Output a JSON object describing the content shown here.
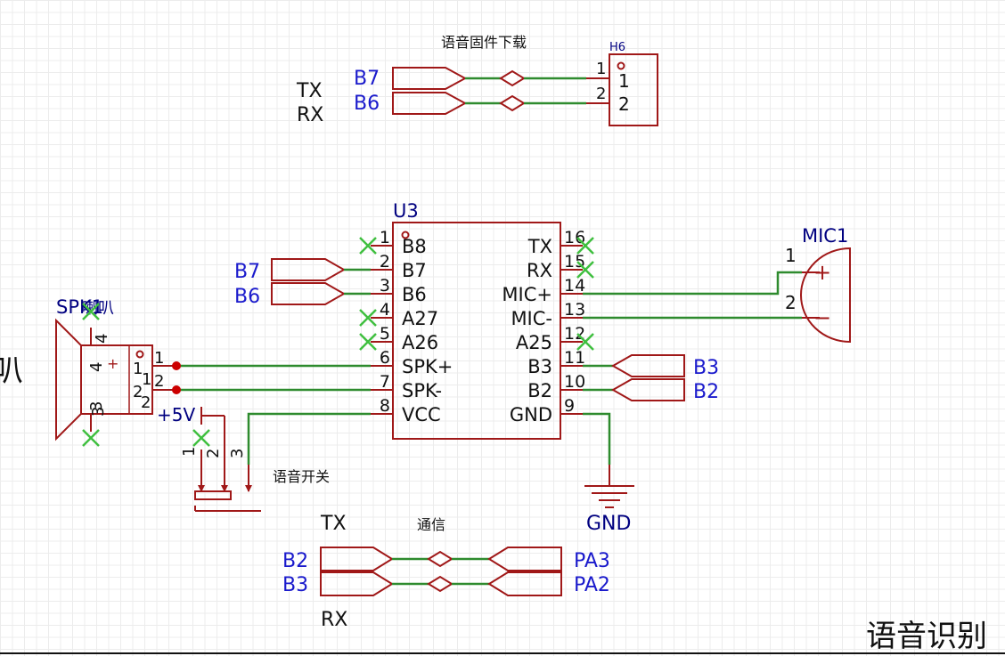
{
  "colors": {
    "wire": "#2e8b2e",
    "symbol": "#a01818",
    "net_label": "#1a1acc",
    "ref_text": "#000080",
    "text": "#111111",
    "noconnect": "#3fbf3f",
    "junction": "#cc0000"
  },
  "title_block": {
    "title": "语音识别"
  },
  "fragment_left": "叭",
  "header_h6": {
    "ref": "H6",
    "caption": "语音固件下载",
    "net_b7": "B7",
    "net_b6": "B6",
    "sig_tx": "TX",
    "sig_rx": "RX",
    "pins": [
      "1",
      "2"
    ],
    "pin_names": [
      "1",
      "2"
    ]
  },
  "u3": {
    "ref": "U3",
    "left_pins": [
      {
        "num": "1",
        "name": "B8",
        "nc": true
      },
      {
        "num": "2",
        "name": "B7",
        "nc": false
      },
      {
        "num": "3",
        "name": "B6",
        "nc": false
      },
      {
        "num": "4",
        "name": "A27",
        "nc": true
      },
      {
        "num": "5",
        "name": "A26",
        "nc": true
      },
      {
        "num": "6",
        "name": "SPK+",
        "nc": false
      },
      {
        "num": "7",
        "name": "SPK-",
        "nc": false
      },
      {
        "num": "8",
        "name": "VCC",
        "nc": false
      }
    ],
    "right_pins": [
      {
        "num": "16",
        "name": "TX",
        "nc": true
      },
      {
        "num": "15",
        "name": "RX",
        "nc": true
      },
      {
        "num": "14",
        "name": "MIC+",
        "nc": false
      },
      {
        "num": "13",
        "name": "MIC-",
        "nc": false
      },
      {
        "num": "12",
        "name": "A25",
        "nc": true
      },
      {
        "num": "11",
        "name": "B3",
        "nc": false
      },
      {
        "num": "10",
        "name": "B2",
        "nc": false
      },
      {
        "num": "9",
        "name": "GND",
        "nc": false
      }
    ],
    "left_nets": [
      "B7",
      "B6"
    ],
    "right_nets": [
      "B3",
      "B2"
    ]
  },
  "mic": {
    "ref": "MIC1",
    "pins": [
      "1",
      "2"
    ],
    "plus": "+",
    "minus": "−"
  },
  "speaker": {
    "ref": "SPK1",
    "ref_overlap": "喇叭",
    "pins_outer": [
      "4",
      "3"
    ],
    "pins_inner": [
      "4",
      "1",
      "2",
      "3"
    ],
    "wire_pins": [
      "1",
      "2"
    ],
    "plus": "+"
  },
  "switch": {
    "caption": "语音开关",
    "power": "+5V",
    "pins": [
      "1",
      "2",
      "3"
    ]
  },
  "ground": {
    "label": "GND"
  },
  "comm": {
    "caption": "通信",
    "sig_tx": "TX",
    "sig_rx": "RX",
    "left_nets": [
      "B2",
      "B3"
    ],
    "right_nets": [
      "PA3",
      "PA2"
    ]
  }
}
